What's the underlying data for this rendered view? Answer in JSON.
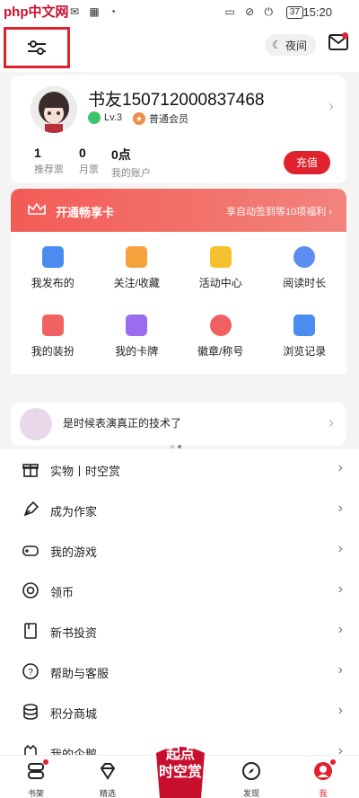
{
  "statusbar": {
    "watermark": "php中文网",
    "battery": "37",
    "time": "15:20"
  },
  "header": {
    "night_label": "夜间"
  },
  "profile": {
    "username": "书友150712000837468",
    "level": "Lv.3",
    "member": "普通会员",
    "stats": [
      {
        "value": "1",
        "label": "推荐票"
      },
      {
        "value": "0",
        "label": "月票"
      },
      {
        "value": "0点",
        "label": "我的账户"
      }
    ],
    "recharge_label": "充值"
  },
  "vip": {
    "title": "开通畅享卡",
    "promo": "享自动签到等10项福利"
  },
  "grid": [
    {
      "label": "我发布的",
      "color": "#4a8cf0"
    },
    {
      "label": "关注/收藏",
      "color": "#f5a23c"
    },
    {
      "label": "活动中心",
      "color": "#f5c12c"
    },
    {
      "label": "阅读时长",
      "color": "#5b8ef0"
    },
    {
      "label": "我的装扮",
      "color": "#f06262"
    },
    {
      "label": "我的卡牌",
      "color": "#9b6cf0"
    },
    {
      "label": "徽章/称号",
      "color": "#f06060"
    },
    {
      "label": "浏览记录",
      "color": "#4a8cf0"
    }
  ],
  "banner": {
    "text": "是时候表演真正的技术了"
  },
  "menu": [
    {
      "label": "实物丨时空赏",
      "icon": "gift-icon"
    },
    {
      "label": "成为作家",
      "icon": "pen-icon"
    },
    {
      "label": "我的游戏",
      "icon": "gamepad-icon"
    },
    {
      "label": "领币",
      "icon": "coin-icon"
    },
    {
      "label": "新书投资",
      "icon": "book-icon"
    },
    {
      "label": "帮助与客服",
      "icon": "help-icon"
    },
    {
      "label": "积分商城",
      "icon": "database-icon"
    },
    {
      "label": "我的企鹅",
      "icon": "penguin-icon"
    }
  ],
  "tabs": [
    {
      "label": "书架"
    },
    {
      "label": "精选"
    },
    {
      "label": "发现"
    },
    {
      "label": "我"
    }
  ],
  "promo_badge": {
    "line1": "起点",
    "line2": "时空赏"
  },
  "colors": {
    "accent": "#e0222e",
    "vip_start": "#f35b55"
  }
}
